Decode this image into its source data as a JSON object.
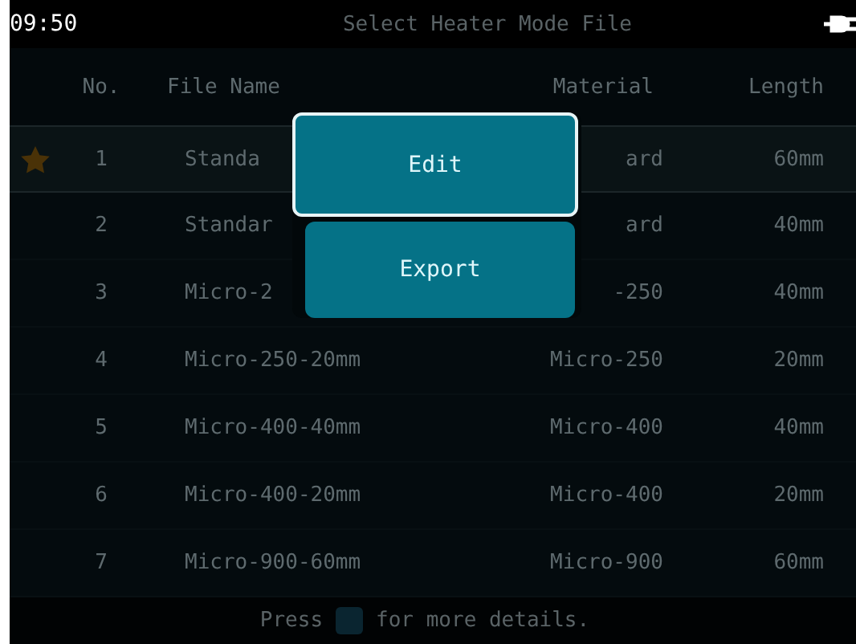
{
  "status_bar": {
    "time": "09:50",
    "title": "Select Heater Mode File"
  },
  "table": {
    "columns": [
      "No.",
      "File Name",
      "Material",
      "Length"
    ],
    "rows": [
      {
        "favorite": true,
        "selected": true,
        "no": "1",
        "file_name": "Standa",
        "material": "ard",
        "length": "60mm"
      },
      {
        "favorite": false,
        "selected": false,
        "no": "2",
        "file_name": "Standar",
        "material": "ard",
        "length": "40mm"
      },
      {
        "favorite": false,
        "selected": false,
        "no": "3",
        "file_name": "Micro-2",
        "material": "-250",
        "length": "40mm"
      },
      {
        "favorite": false,
        "selected": false,
        "no": "4",
        "file_name": "Micro-250-20mm",
        "material": "Micro-250",
        "length": "20mm"
      },
      {
        "favorite": false,
        "selected": false,
        "no": "5",
        "file_name": "Micro-400-40mm",
        "material": "Micro-400",
        "length": "40mm"
      },
      {
        "favorite": false,
        "selected": false,
        "no": "6",
        "file_name": "Micro-400-20mm",
        "material": "Micro-400",
        "length": "20mm"
      },
      {
        "favorite": false,
        "selected": false,
        "no": "7",
        "file_name": "Micro-900-60mm",
        "material": "Micro-900",
        "length": "60mm"
      }
    ]
  },
  "footer": {
    "before": "Press",
    "after": "for more details."
  },
  "menu": [
    {
      "label": "Edit",
      "selected": true
    },
    {
      "label": "Export",
      "selected": false
    }
  ]
}
